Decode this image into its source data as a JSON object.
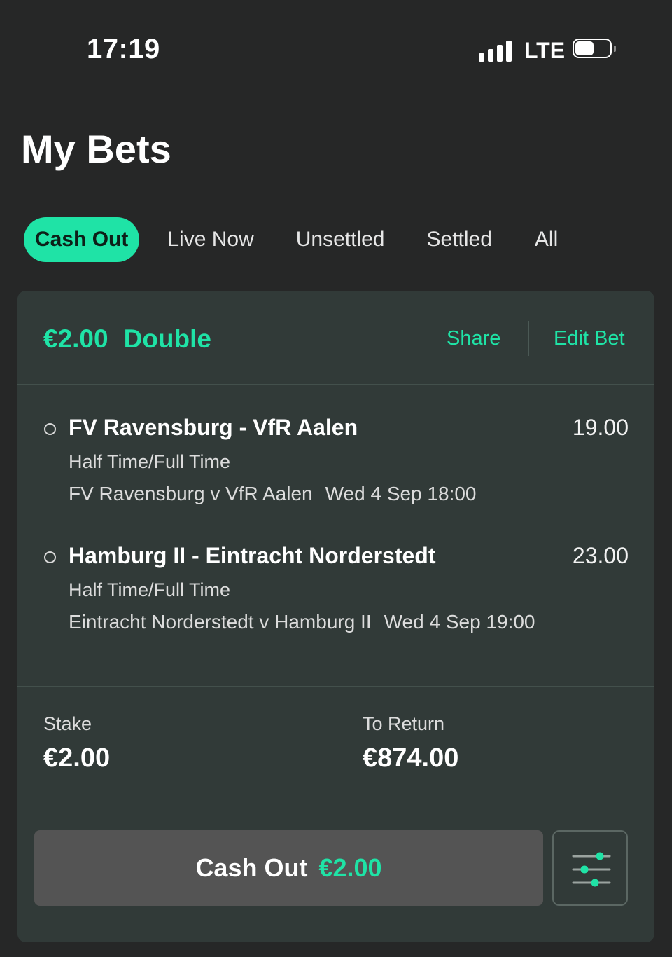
{
  "status_bar": {
    "time": "17:19",
    "network": "LTE",
    "signal_icon": "signal-bars-icon",
    "battery_icon": "battery-icon"
  },
  "page_title": "My Bets",
  "tabs": [
    {
      "label": "Cash Out",
      "active": true
    },
    {
      "label": "Live Now",
      "active": false
    },
    {
      "label": "Unsettled",
      "active": false
    },
    {
      "label": "Settled",
      "active": false
    },
    {
      "label": "All",
      "active": false
    }
  ],
  "bet": {
    "stake_amount": "€2.00",
    "bet_type": "Double",
    "share_label": "Share",
    "edit_label": "Edit Bet",
    "selections": [
      {
        "title": "FV Ravensburg - VfR Aalen",
        "odds": "19.00",
        "market": "Half Time/Full Time",
        "event": "FV Ravensburg v VfR Aalen",
        "datetime": "Wed 4 Sep 18:00"
      },
      {
        "title": "Hamburg II - Eintracht Norderstedt",
        "odds": "23.00",
        "market": "Half Time/Full Time",
        "event": "Eintracht Norderstedt v Hamburg II",
        "datetime": "Wed 4 Sep 19:00"
      }
    ],
    "stake_label": "Stake",
    "stake_value": "€2.00",
    "return_label": "To Return",
    "return_value": "€874.00",
    "cashout_label": "Cash Out",
    "cashout_amount": "€2.00",
    "settings_icon": "sliders-icon"
  },
  "colors": {
    "accent": "#1fe3a6",
    "background": "#262727",
    "card": "#313a38",
    "button": "#545454"
  }
}
